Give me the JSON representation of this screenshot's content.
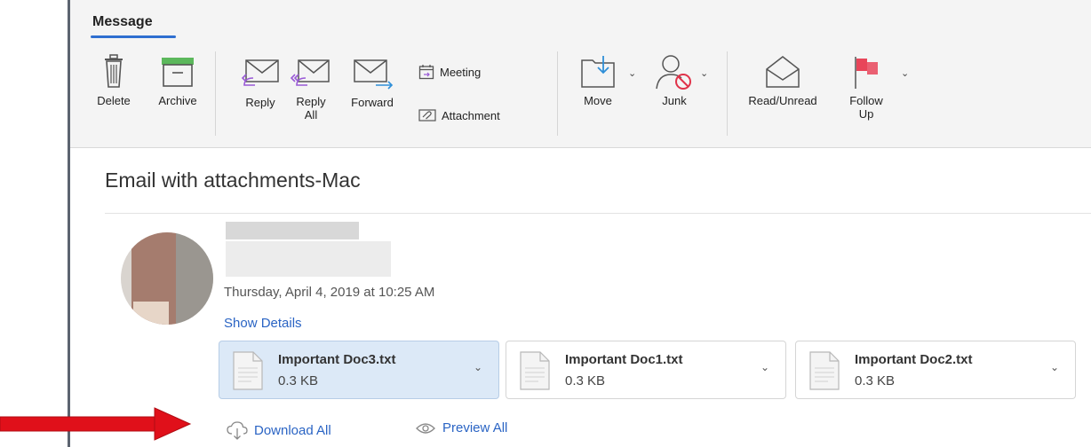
{
  "ribbon": {
    "tab_label": "Message",
    "delete_label": "Delete",
    "archive_label": "Archive",
    "reply_label": "Reply",
    "reply_all_line1": "Reply",
    "reply_all_line2": "All",
    "forward_label": "Forward",
    "meeting_label": "Meeting",
    "attachment_label": "Attachment",
    "move_label": "Move",
    "junk_label": "Junk",
    "read_unread_label": "Read/Unread",
    "follow_up_line1": "Follow",
    "follow_up_line2": "Up"
  },
  "message": {
    "subject": "Email with attachments-Mac",
    "date": "Thursday, April 4, 2019 at 10:25 AM",
    "show_details": "Show Details"
  },
  "attachments": [
    {
      "name": "Important Doc3.txt",
      "size": "0.3 KB",
      "selected": true
    },
    {
      "name": "Important Doc1.txt",
      "size": "0.3 KB",
      "selected": false
    },
    {
      "name": "Important Doc2.txt",
      "size": "0.3 KB",
      "selected": false
    }
  ],
  "actions": {
    "download_all": "Download All",
    "preview_all": "Preview All"
  },
  "icons": {
    "delete": "trash-icon",
    "archive": "archive-box-icon",
    "reply": "reply-envelope-icon",
    "reply_all": "reply-all-envelope-icon",
    "forward": "forward-envelope-icon",
    "meeting": "calendar-icon",
    "attachment": "paperclip-icon",
    "move": "folder-move-icon",
    "junk": "junk-person-icon",
    "read_unread": "open-envelope-icon",
    "follow_up": "flag-icon",
    "download": "cloud-download-icon",
    "preview": "eye-icon"
  },
  "colors": {
    "accent": "#2f6fd0",
    "link": "#2a64c4",
    "flag": "#e8455a",
    "annotation_arrow": "#e0101a"
  }
}
